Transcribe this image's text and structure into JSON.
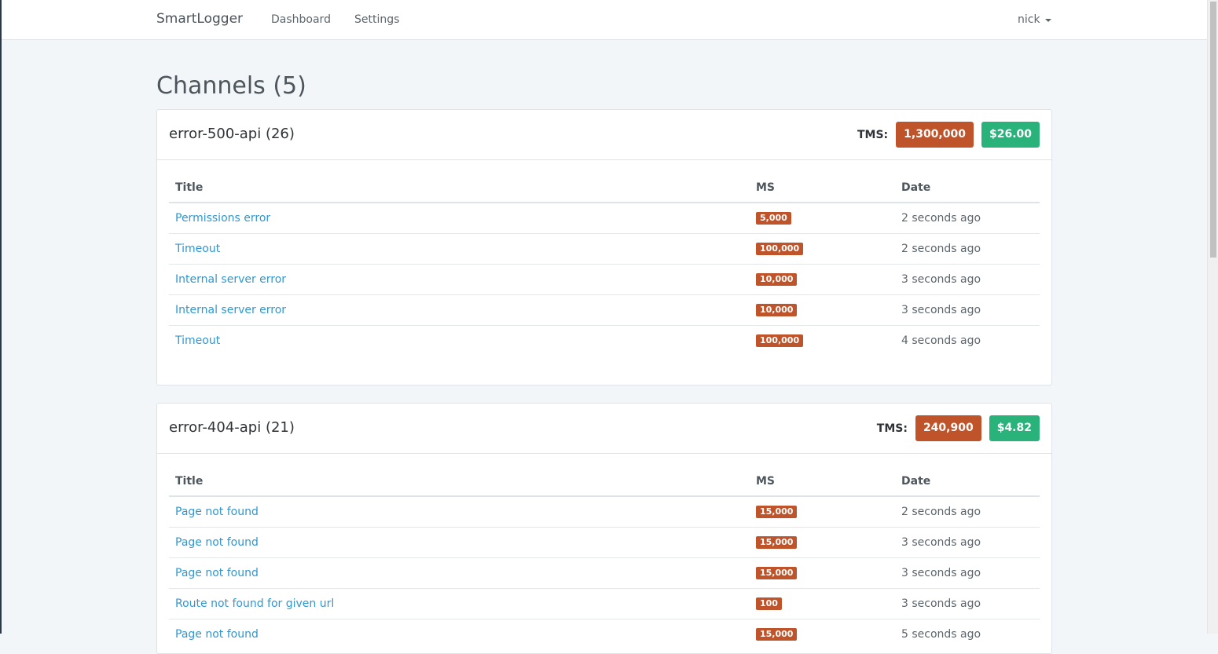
{
  "navbar": {
    "brand": "SmartLogger",
    "links": [
      "Dashboard",
      "Settings"
    ],
    "user": "nick"
  },
  "page": {
    "title": "Channels (5)"
  },
  "table_headers": [
    "Title",
    "MS",
    "Date"
  ],
  "channels": [
    {
      "title": "error-500-api (26)",
      "tms_label": "TMS:",
      "tms_value": "1,300,000",
      "cost": "$26.00",
      "rows": [
        {
          "title": "Permissions error",
          "ms": "5,000",
          "date": "2 seconds ago"
        },
        {
          "title": "Timeout",
          "ms": "100,000",
          "date": "2 seconds ago"
        },
        {
          "title": "Internal server error",
          "ms": "10,000",
          "date": "3 seconds ago"
        },
        {
          "title": "Internal server error",
          "ms": "10,000",
          "date": "3 seconds ago"
        },
        {
          "title": "Timeout",
          "ms": "100,000",
          "date": "4 seconds ago"
        }
      ]
    },
    {
      "title": "error-404-api (21)",
      "tms_label": "TMS:",
      "tms_value": "240,900",
      "cost": "$4.82",
      "rows": [
        {
          "title": "Page not found",
          "ms": "15,000",
          "date": "2 seconds ago"
        },
        {
          "title": "Page not found",
          "ms": "15,000",
          "date": "3 seconds ago"
        },
        {
          "title": "Page not found",
          "ms": "15,000",
          "date": "3 seconds ago"
        },
        {
          "title": "Route not found for given url",
          "ms": "100",
          "date": "3 seconds ago"
        },
        {
          "title": "Page not found",
          "ms": "15,000",
          "date": "5 seconds ago"
        }
      ]
    }
  ],
  "colors": {
    "danger": "#bf5329",
    "success": "#2ab27b",
    "link": "#3097d1",
    "background": "#f2f6f9"
  }
}
